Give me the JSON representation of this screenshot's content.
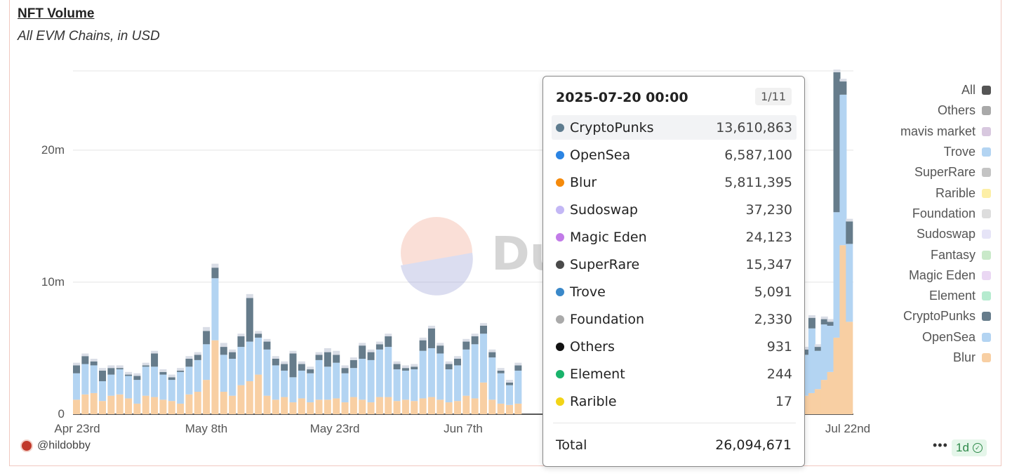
{
  "header": {
    "title": "NFT Volume",
    "subtitle": "All EVM Chains, in USD"
  },
  "watermark": "Du",
  "colors": {
    "Blur": "#f8cfa3",
    "OpenSea": "#b3d4f2",
    "CryptoPunks": "#667c8b",
    "Others": "#d9dde6",
    "gridline": "#e4e4e4"
  },
  "chart_data": {
    "type": "bar",
    "stacked": true,
    "x_tick_labels": [
      "Apr 23rd",
      "May 8th",
      "May 23rd",
      "Jun 7th",
      "Jul 22nd"
    ],
    "y_tick_labels": [
      "0",
      "10m",
      "20m"
    ],
    "ylim": [
      0,
      26000000
    ],
    "note_series_order": [
      "Blur",
      "OpenSea",
      "CryptoPunks",
      "Others"
    ],
    "legend": [
      {
        "name": "All",
        "color": "#555555"
      },
      {
        "name": "Others",
        "color": "#a9a9a9"
      },
      {
        "name": "mavis market",
        "color": "#d8c8df"
      },
      {
        "name": "Trove",
        "color": "#b3d4f2"
      },
      {
        "name": "SuperRare",
        "color": "#c4c4c4"
      },
      {
        "name": "Rarible",
        "color": "#fdefa6"
      },
      {
        "name": "Foundation",
        "color": "#dddddd"
      },
      {
        "name": "Sudoswap",
        "color": "#e6e4f7"
      },
      {
        "name": "Fantasy",
        "color": "#c9e9c9"
      },
      {
        "name": "Magic Eden",
        "color": "#ead7f3"
      },
      {
        "name": "Element",
        "color": "#b5ebcf"
      },
      {
        "name": "CryptoPunks",
        "color": "#667c8b"
      },
      {
        "name": "OpenSea",
        "color": "#b3d4f2"
      },
      {
        "name": "Blur",
        "color": "#f8cfa3"
      }
    ],
    "bars": [
      [
        1.1,
        2.0,
        0.6,
        0.2
      ],
      [
        1.5,
        2.3,
        0.6,
        0.2
      ],
      [
        1.6,
        2.1,
        0.3,
        0.2
      ],
      [
        1.0,
        1.5,
        0.8,
        0.2
      ],
      [
        1.4,
        1.6,
        0.5,
        0.2
      ],
      [
        1.5,
        1.9,
        0.1,
        0.2
      ],
      [
        1.2,
        1.7,
        0.1,
        0.2
      ],
      [
        0.8,
        1.8,
        0.3,
        0.2
      ],
      [
        1.4,
        2.2,
        0.1,
        0.2
      ],
      [
        1.3,
        2.3,
        1.0,
        0.2
      ],
      [
        1.1,
        1.9,
        0.2,
        0.2
      ],
      [
        1.0,
        1.6,
        0.2,
        0.2
      ],
      [
        0.8,
        2.4,
        0.1,
        0.2
      ],
      [
        1.5,
        2.1,
        0.6,
        0.2
      ],
      [
        1.7,
        2.4,
        0.4,
        0.2
      ],
      [
        2.6,
        2.7,
        1.0,
        0.3
      ],
      [
        5.6,
        4.7,
        0.8,
        0.3
      ],
      [
        1.7,
        2.8,
        0.6,
        0.3
      ],
      [
        1.4,
        2.8,
        0.5,
        0.2
      ],
      [
        2.2,
        2.9,
        0.8,
        0.2
      ],
      [
        2.5,
        3.0,
        3.3,
        0.3
      ],
      [
        3.0,
        2.8,
        0.3,
        0.2
      ],
      [
        1.4,
        3.5,
        0.6,
        0.2
      ],
      [
        1.1,
        2.6,
        0.5,
        0.2
      ],
      [
        1.3,
        2.0,
        0.5,
        0.2
      ],
      [
        0.9,
        1.9,
        1.8,
        0.2
      ],
      [
        1.2,
        2.1,
        0.5,
        0.2
      ],
      [
        0.9,
        2.2,
        0.3,
        0.2
      ],
      [
        1.1,
        3.0,
        0.4,
        0.2
      ],
      [
        1.1,
        2.5,
        1.1,
        0.3
      ],
      [
        1.2,
        2.7,
        0.6,
        0.3
      ],
      [
        0.9,
        2.2,
        0.4,
        0.2
      ],
      [
        1.3,
        2.2,
        0.6,
        0.2
      ],
      [
        1.1,
        3.1,
        1.0,
        0.2
      ],
      [
        0.9,
        3.2,
        0.6,
        0.2
      ],
      [
        1.3,
        3.6,
        0.4,
        0.2
      ],
      [
        1.3,
        3.8,
        0.8,
        0.2
      ],
      [
        1.0,
        2.4,
        0.4,
        0.2
      ],
      [
        1.1,
        2.2,
        0.2,
        0.2
      ],
      [
        1.0,
        2.4,
        0.2,
        0.2
      ],
      [
        1.2,
        3.6,
        0.8,
        0.2
      ],
      [
        1.3,
        3.7,
        1.5,
        0.2
      ],
      [
        1.1,
        3.5,
        0.6,
        0.2
      ],
      [
        0.9,
        2.5,
        0.4,
        0.2
      ],
      [
        1.0,
        2.7,
        0.5,
        0.2
      ],
      [
        1.4,
        3.5,
        0.6,
        0.2
      ],
      [
        1.2,
        4.1,
        0.6,
        0.2
      ],
      [
        2.4,
        3.7,
        0.6,
        0.2
      ],
      [
        1.1,
        3.2,
        0.4,
        0.2
      ],
      [
        0.8,
        2.3,
        0.2,
        0.2
      ],
      [
        0.7,
        1.5,
        0.2,
        0.2
      ],
      [
        0.8,
        2.5,
        0.4,
        0.2
      ]
    ],
    "right_bars": [
      [
        1.4,
        3.1,
        0.4,
        0.2
      ],
      [
        1.6,
        4.9,
        0.8,
        0.2
      ],
      [
        1.9,
        2.9,
        0.3,
        0.2
      ],
      [
        2.6,
        4.2,
        0.4,
        0.2
      ],
      [
        3.2,
        3.5,
        0.3,
        0.2
      ],
      [
        5.8,
        9.5,
        10.6,
        0.2
      ],
      [
        12.8,
        11.4,
        1.0,
        0.2
      ],
      [
        7.0,
        5.9,
        1.7,
        0.2
      ]
    ]
  },
  "tooltip": {
    "date": "2025-07-20 00:00",
    "page": "1/11",
    "rows": [
      {
        "name": "CryptoPunks",
        "value": "13,610,863",
        "color": "#5e7c8f"
      },
      {
        "name": "OpenSea",
        "value": "6,587,100",
        "color": "#2b84e3"
      },
      {
        "name": "Blur",
        "value": "5,811,395",
        "color": "#f58a0b"
      },
      {
        "name": "Sudoswap",
        "value": "37,230",
        "color": "#c3b7f5"
      },
      {
        "name": "Magic Eden",
        "value": "24,123",
        "color": "#c27be8"
      },
      {
        "name": "SuperRare",
        "value": "15,347",
        "color": "#4a4a4a"
      },
      {
        "name": "Trove",
        "value": "5,091",
        "color": "#3a88c9"
      },
      {
        "name": "Foundation",
        "value": "2,330",
        "color": "#aaaaaa"
      },
      {
        "name": "Others",
        "value": "931",
        "color": "#111111"
      },
      {
        "name": "Element",
        "value": "244",
        "color": "#19b36b"
      },
      {
        "name": "Rarible",
        "value": "17",
        "color": "#f2d417"
      }
    ],
    "total_label": "Total",
    "total_value": "26,094,671"
  },
  "footer": {
    "author": "@hildobby",
    "more_icon": "ellipsis-icon",
    "refresh_badge": "1d",
    "badge_icon": "check-circle-icon"
  }
}
